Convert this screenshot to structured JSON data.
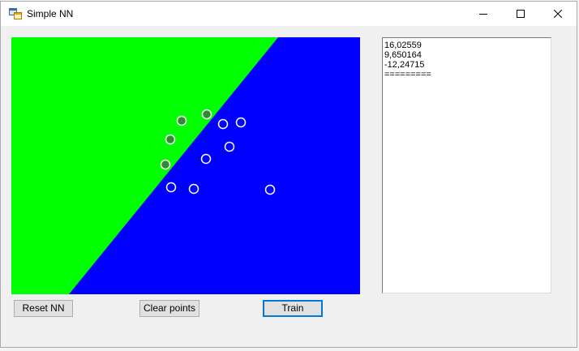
{
  "window": {
    "title": "Simple NN"
  },
  "output": {
    "lines": [
      "16,02559",
      "9,650164",
      "-12,24715",
      "========="
    ]
  },
  "buttons": {
    "reset": "Reset NN",
    "clear": "Clear points",
    "train": "Train"
  },
  "colors": {
    "region_a": "#00ff00",
    "region_b": "#0000ff",
    "point_a_fill": "#2e8b2e",
    "point_b_fill": "#0000ff",
    "point_stroke": "#ffffff",
    "focus_border": "#0078d7"
  }
}
